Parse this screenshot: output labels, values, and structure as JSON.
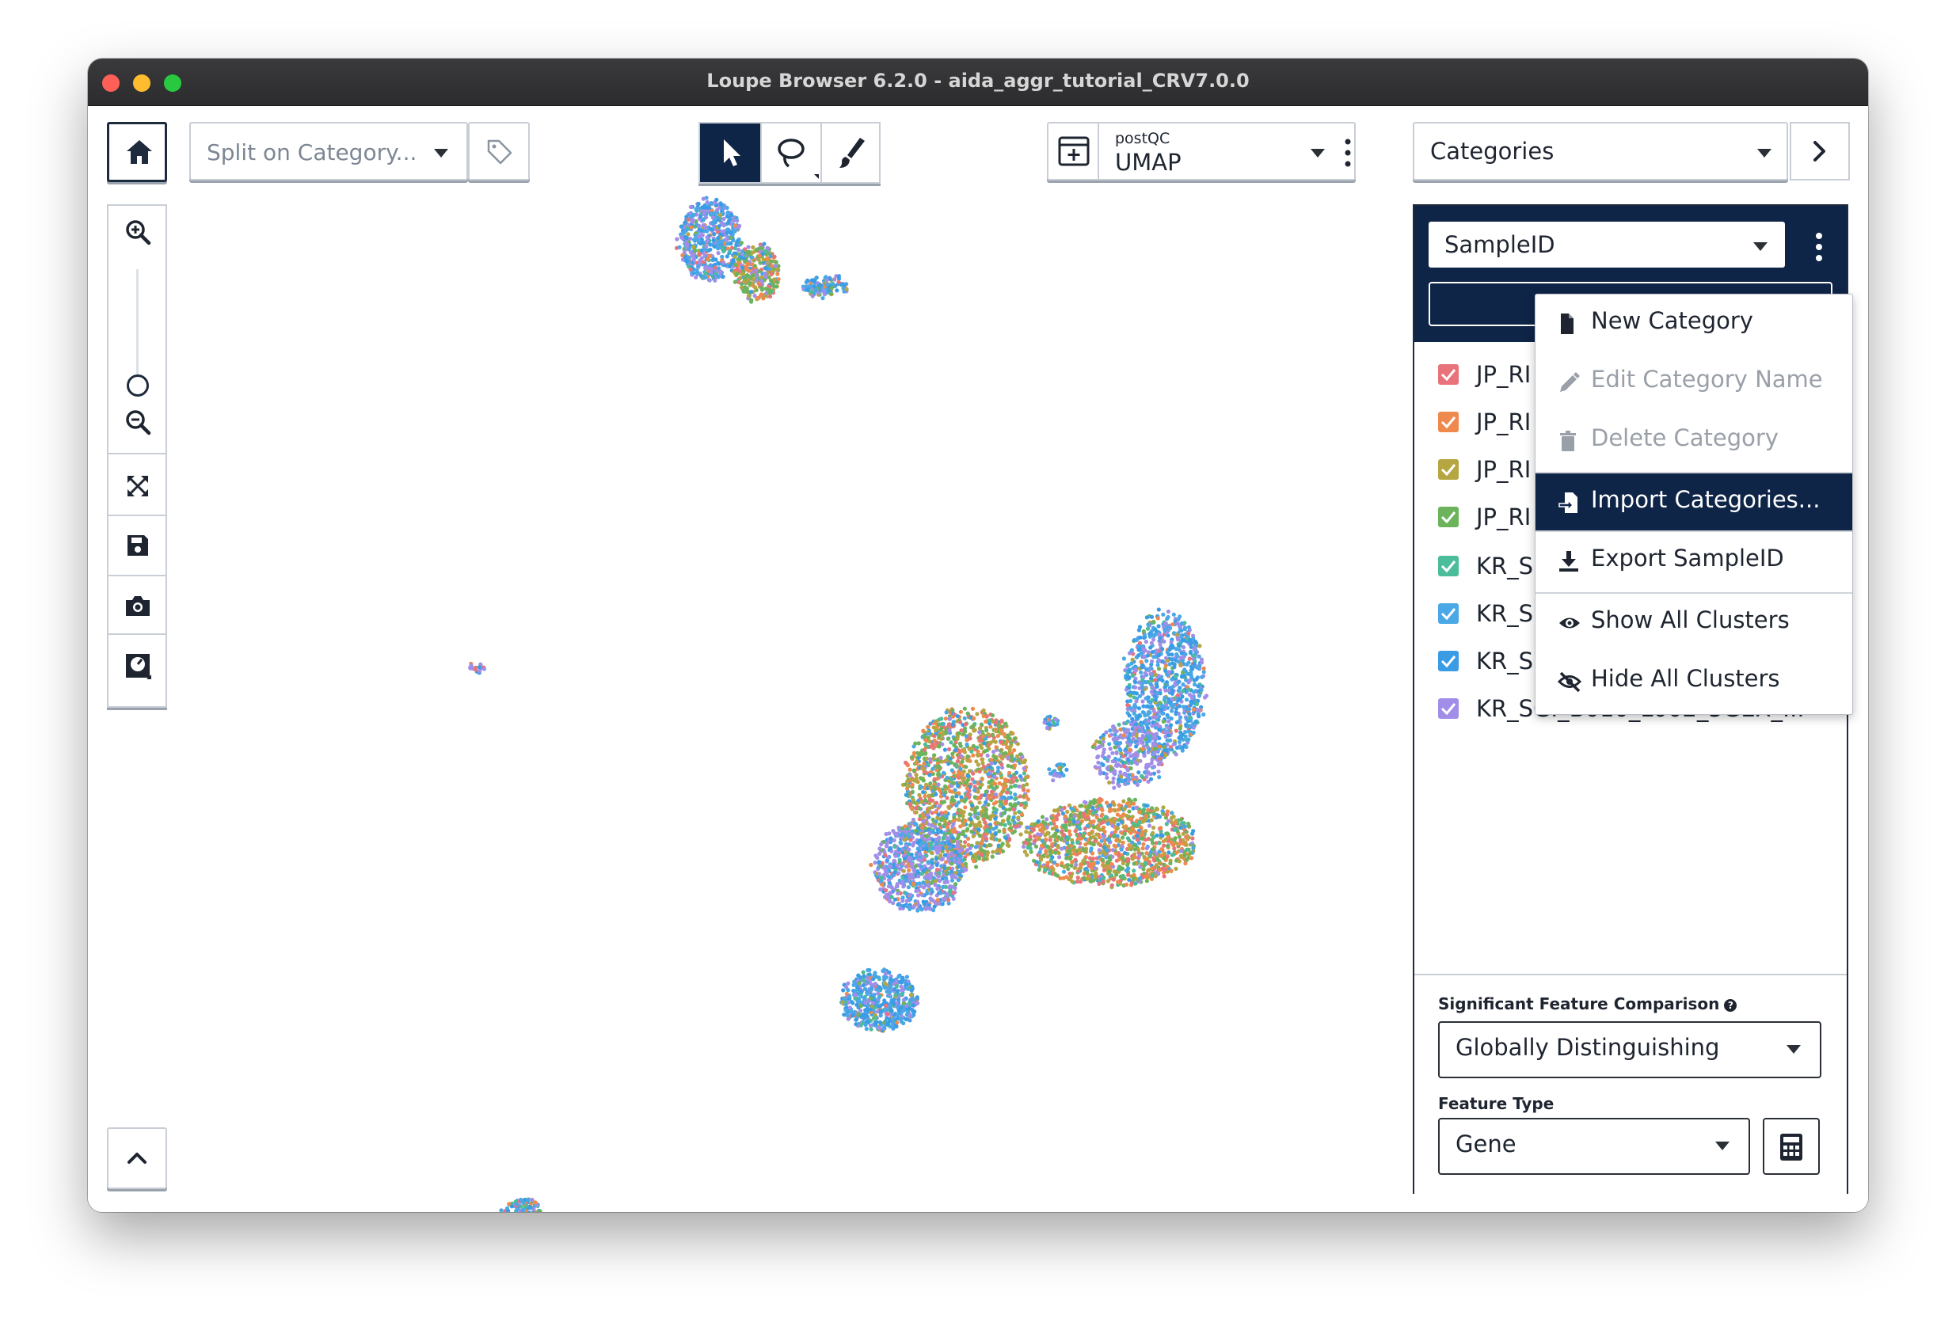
{
  "window": {
    "title": "Loupe Browser 6.2.0 - aida_aggr_tutorial_CRV7.0.0"
  },
  "toolbar": {
    "split_placeholder": "Split on Category...",
    "projection": {
      "small_label": "postQC",
      "value": "UMAP"
    },
    "view_select": "Categories"
  },
  "panel": {
    "category_select": "SampleID",
    "categories": [
      {
        "label": "JP_RI",
        "color": "#e8737a"
      },
      {
        "label": "JP_RI",
        "color": "#ee8a4e"
      },
      {
        "label": "JP_RI",
        "color": "#b5a642"
      },
      {
        "label": "JP_RI",
        "color": "#6cb35c"
      },
      {
        "label": "KR_S",
        "color": "#4bbd9a"
      },
      {
        "label": "KR_S",
        "color": "#4aa8e6"
      },
      {
        "label": "KR_S",
        "color": "#3b9ce6"
      },
      {
        "label": "KR_SGI_B010_L002_5GEX_...",
        "color": "#a28ee8"
      }
    ],
    "sfc_label": "Significant Feature Comparison",
    "sfc_value": "Globally Distinguishing",
    "feature_type_label": "Feature Type",
    "feature_type_value": "Gene"
  },
  "context_menu": {
    "items": [
      {
        "label": "New Category",
        "icon": "file-icon",
        "state": "enabled"
      },
      {
        "label": "Edit Category Name",
        "icon": "pencil-icon",
        "state": "disabled"
      },
      {
        "label": "Delete Category",
        "icon": "trash-icon",
        "state": "disabled"
      },
      {
        "label": "Import Categories...",
        "icon": "import-icon",
        "state": "highlighted"
      },
      {
        "label": "Export SampleID",
        "icon": "download-icon",
        "state": "enabled"
      },
      {
        "label": "Show All Clusters",
        "icon": "eye-icon",
        "state": "enabled"
      },
      {
        "label": "Hide All Clusters",
        "icon": "eye-off-icon",
        "state": "enabled"
      }
    ]
  },
  "colors": {
    "navy": "#0f2547",
    "sample_palette": [
      "#e8737a",
      "#ee8a4e",
      "#b5a642",
      "#6cb35c",
      "#4bbd9a",
      "#4aa8e6",
      "#3b9ce6",
      "#a28ee8"
    ]
  }
}
